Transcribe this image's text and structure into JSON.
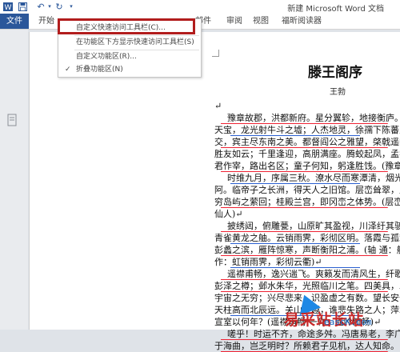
{
  "quick_access": {
    "icons": [
      "word-logo-icon",
      "save-icon",
      "undo-icon",
      "redo-icon",
      "customize-qat-dropdown-icon"
    ]
  },
  "window": {
    "title": "新建 Microsoft Word 文档"
  },
  "ribbon": {
    "file_tab": "文件",
    "tabs": [
      "开始",
      "邮件",
      "审阅",
      "视图",
      "福昕阅读器"
    ]
  },
  "dropdown": {
    "items": [
      {
        "label": "自定义快速访问工具栏(C)...",
        "checked": false,
        "highlighted": true
      },
      {
        "label": "在功能区下方显示快速访问工具栏(S)",
        "checked": false
      },
      {
        "label": "自定义功能区(R)...",
        "checked": false
      },
      {
        "label": "折叠功能区(N)",
        "checked": true
      }
    ]
  },
  "document": {
    "title": "滕王阁序",
    "author": "王勃",
    "lines": [
      "↵",
      "豫章故郡，洪都新府。星分翼轸，地接衡庐。襟三江",
      "天宝，龙光射牛斗之墟；人杰地灵，徐孺下陈蕃之榻。雄",
      "交，宾主尽东南之美。都督阎公之雅望，棨戟遥临；宇文新",
      "胜友如云；千里逢迎，高朋满座。腾蛟起凤，孟学士之词",
      "君作宰，路出名区；童子何知，躬逢胜饯。(豫章故郡　一",
      "时维九月，序属三秋。潦水尽而寒潭清，烟光凝而暮",
      "阿。临帝子之长洲，得天人之旧馆。层峦耸翠，上出重霄",
      "穷岛屿之萦回；桂殿兰宫，即冈峦之体势。(层峦　一作：",
      "仙人)↵",
      "披绣闼，俯雕甍，山原旷其盈视，川泽纡其骇瞩。闾阎",
      "青雀黄龙之舳。云销雨霁，彩彻区明。落霞与孤鹜齐飞，",
      "彭蠡之滨，雁阵惊寒，声断衡阳之浦。(轴 通：舳；迷津",
      "作：虹销雨霁，彩彻云衢)↵",
      "遥襟甫畅，逸兴遄飞。爽籁发而清风生，纤歌凝而白",
      "彭泽之樽；邺水朱华，光照临川之笔。四美具，二难并。穷睇眄于中",
      "宇宙之无穷；兴尽悲来，识盈虚之有数。望长安于日下，",
      "天柱高而北辰远。关山难越，谁悲失路之人；萍水相逢，",
      "宣室以何年？(遥襟甫畅 一作：遥吟俯畅)↵",
      "嗟乎！时运不齐，命途多舛。冯唐易老，李广难封。",
      "于海曲，岂乏明时？所赖君子见机，达人知命。"
    ]
  },
  "watermark": {
    "text": "易采站长站",
    "url": "eascK.com"
  }
}
